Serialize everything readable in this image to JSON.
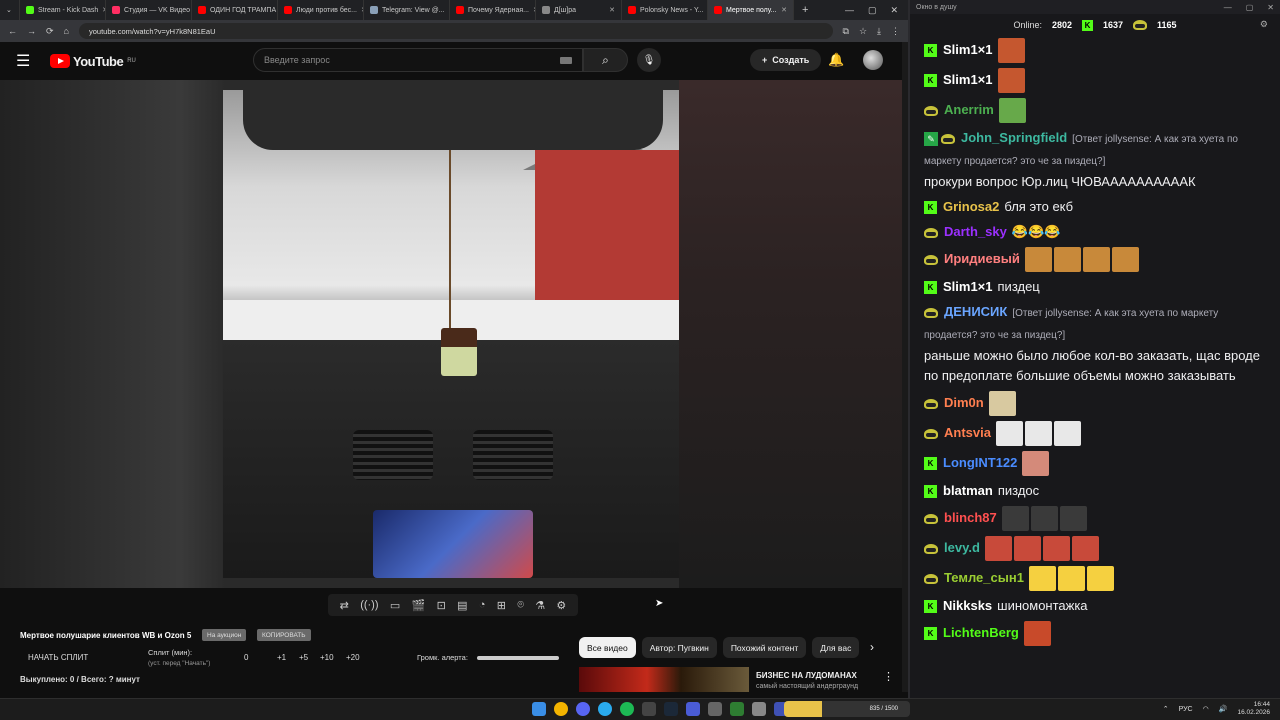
{
  "browser": {
    "tabs": [
      {
        "title": "Stream - Kick Dash",
        "color": "#53fc18",
        "active": false
      },
      {
        "title": "Студия — VK Видео",
        "color": "#ff2e63",
        "active": false
      },
      {
        "title": "ОДИН ГОД ТРАМПА",
        "color": "#ff0000",
        "active": false
      },
      {
        "title": "Люди против бес...",
        "color": "#ff0000",
        "active": false
      },
      {
        "title": "Telegram: View @...",
        "color": "#8aa0b8",
        "active": false
      },
      {
        "title": "Почему Ядерная...",
        "color": "#ff0000",
        "active": false
      },
      {
        "title": "Д[ш]ра",
        "color": "#888888",
        "active": false
      },
      {
        "title": "Polonsky News - Y...",
        "color": "#ff0000",
        "active": false
      },
      {
        "title": "Мертвое полу...",
        "color": "#ff0000",
        "active": true
      }
    ],
    "new_tab": "+",
    "url": "youtube.com/watch?v=yH7k8N81EaU"
  },
  "youtube": {
    "logo_text": "YouTube",
    "logo_region": "RU",
    "search_placeholder": "Введите запрос",
    "create_label": "Создать"
  },
  "player_toolbar": {
    "icons": [
      "loop-icon",
      "broadcast-icon",
      "screen-icon",
      "clapper-icon",
      "frame-icon",
      "film-icon",
      "speed-icon",
      "add-icon",
      "camera-icon",
      "flask-icon",
      "settings-icon"
    ]
  },
  "controls": {
    "title": "Мертвое полушарие клиентов WB и Ozon 5",
    "pill_auction": "На аукцион",
    "pill_copy": "КОПИРОВАТЬ",
    "start_split": "НАЧАТЬ СПЛИТ",
    "split_label": "Сплит (мин):",
    "split_sub": "(уст. перед \"Начать\")",
    "split_values": [
      "0",
      "+1",
      "+5",
      "+10",
      "+20"
    ],
    "alert_volume_label": "Громк. алерта:",
    "alert_volume": 1.0,
    "bought": "Выкуплено: 0 / Всего: ? минут"
  },
  "chips": [
    "Все видео",
    "Автор: Пугвкин",
    "Похожий контент",
    "Для вас"
  ],
  "recommendation": {
    "title": "БИЗНЕС НА ЛУДОМАНАХ",
    "subtitle": "самый настоящий андерграунд"
  },
  "chat": {
    "window_title": "Окно в душу",
    "online_label": "Online:",
    "online_count": "2802",
    "kick_count": "1637",
    "other_count": "1165",
    "messages": [
      {
        "badge": "kick",
        "user": "Slim1×1",
        "color": "#ffffff",
        "text": "",
        "emotes": 1,
        "emote_color": "#c5572f"
      },
      {
        "badge": "kick",
        "user": "Slim1×1",
        "color": "#ffffff",
        "text": "",
        "emotes": 1,
        "emote_color": "#c5572f"
      },
      {
        "badge": "pepe",
        "user": "Anerrim",
        "color": "#4caf50",
        "text": "",
        "emotes": 1,
        "emote_color": "#67a94a"
      },
      {
        "badge": "mod",
        "user": "John_Springfield",
        "color": "#3db8a0",
        "reply": "[Ответ jollysense: А как эта хуета по маркету продается? это че за пиздец?]",
        "text": "прокури вопрос Юр.лиц ЧЮВААААААААААК",
        "emotes": 0
      },
      {
        "badge": "kick",
        "user": "Grinosa2",
        "color": "#e8c24a",
        "text": "бля это екб",
        "emotes": 0
      },
      {
        "badge": "pepe",
        "user": "Darth_sky",
        "color": "#9b30ff",
        "text": "😂😂😂",
        "emotes": 0
      },
      {
        "badge": "pepe",
        "user": "Иридиевый",
        "color": "#ff7f7f",
        "text": "",
        "emotes": 4,
        "emote_color": "#c8893a"
      },
      {
        "badge": "kick",
        "user": "Slim1×1",
        "color": "#ffffff",
        "text": "пиздец",
        "emotes": 0
      },
      {
        "badge": "pepe",
        "user": "ДЕНИСИК",
        "color": "#6aa5ff",
        "reply": "[Ответ jollysense: А как эта хуета по маркету продается? это че за пиздец?]",
        "text": "раньше можно было любое кол-во заказать, щас вроде по предоплате большие объемы можно заказывать",
        "emotes": 0
      },
      {
        "badge": "pepe",
        "user": "Dim0n",
        "color": "#ff7f50",
        "text": "",
        "emotes": 1,
        "emote_color": "#d8c9a0"
      },
      {
        "badge": "pepe",
        "user": "Antsvia",
        "color": "#ff7f50",
        "text": "",
        "emotes": 3,
        "emote_color": "#e8e8e8"
      },
      {
        "badge": "kick",
        "user": "LongINT122",
        "color": "#4a8cff",
        "text": "",
        "emotes": 1,
        "emote_color": "#d48a7a"
      },
      {
        "badge": "kick",
        "user": "blatman",
        "color": "#ffffff",
        "text": "пиздос",
        "emotes": 0
      },
      {
        "badge": "pepe",
        "user": "blinch87",
        "color": "#ff5050",
        "text": "",
        "emotes": 3,
        "emote_color": "#3a3a3a"
      },
      {
        "badge": "pepe",
        "user": "levy.d",
        "color": "#3db8a0",
        "text": "",
        "emotes": 4,
        "emote_color": "#c84a3a"
      },
      {
        "badge": "pepe",
        "user": "Темле_сын1",
        "color": "#9acd32",
        "text": "",
        "emotes": 3,
        "emote_color": "#f5d040"
      },
      {
        "badge": "kick",
        "user": "Nikksks",
        "color": "#ffffff",
        "text": "шиномонтажка",
        "emotes": 0
      },
      {
        "badge": "kick",
        "user": "LichtenBerg",
        "color": "#53fc18",
        "text": "",
        "emotes": 1,
        "emote_color": "#c84a2a"
      }
    ]
  },
  "taskbar": {
    "lang": "РУС",
    "time": "16:44",
    "date": "16.02.2026",
    "widget": "835 / 1500"
  }
}
